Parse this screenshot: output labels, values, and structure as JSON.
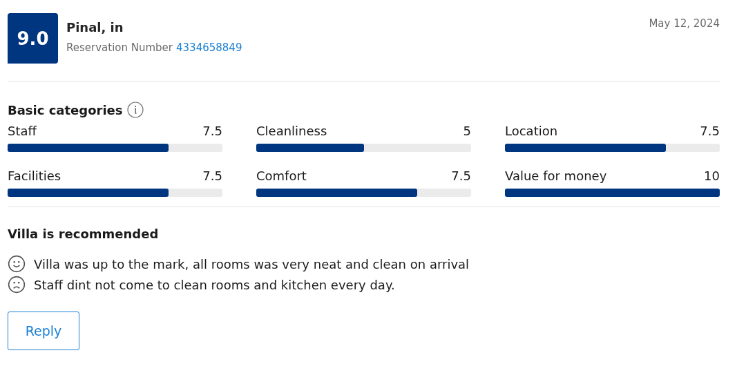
{
  "review": {
    "score": "9.0",
    "guest": "Pinal, in",
    "reservation_label": "Reservation Number",
    "reservation_number": "4334658849",
    "date": "May 12, 2024"
  },
  "categories_title": "Basic categories",
  "categories": [
    {
      "name": "Staff",
      "score": "7.5",
      "level": 0.75
    },
    {
      "name": "Cleanliness",
      "score": "5",
      "level": 0.5
    },
    {
      "name": "Location",
      "score": "7.5",
      "level": 0.75
    },
    {
      "name": "Facilities",
      "score": "7.5",
      "level": 0.75
    },
    {
      "name": "Comfort",
      "score": "7.5",
      "level": 0.75
    },
    {
      "name": "Value for money",
      "score": "10",
      "level": 1
    }
  ],
  "headline": "Villa is recommended",
  "comments": [
    {
      "kind": "positive",
      "text": "Villa was up to the mark, all rooms was very neat and clean on arrival"
    },
    {
      "kind": "negative",
      "text": "Staff dint not come to clean rooms and kitchen every day."
    }
  ],
  "reply_button": "Reply"
}
